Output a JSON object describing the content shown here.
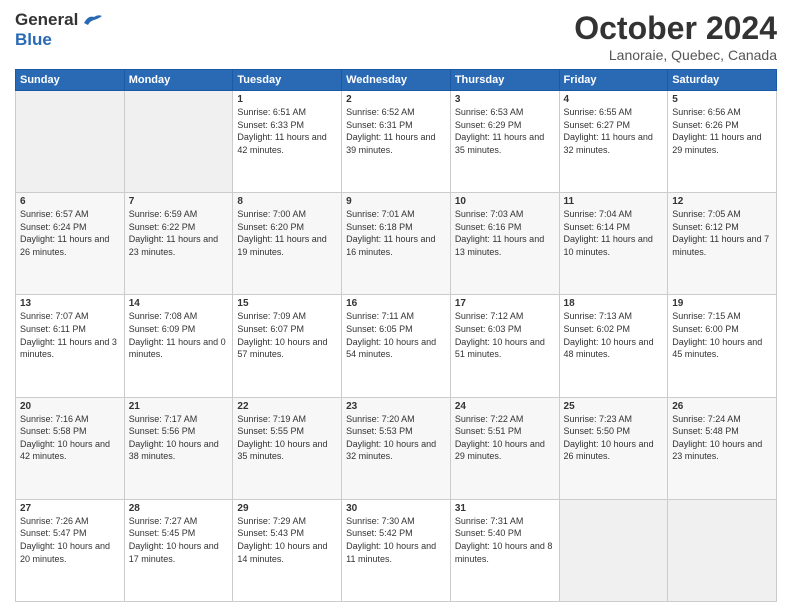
{
  "logo": {
    "line1": "General",
    "line2": "Blue"
  },
  "header": {
    "month_title": "October 2024",
    "location": "Lanoraie, Quebec, Canada"
  },
  "weekdays": [
    "Sunday",
    "Monday",
    "Tuesday",
    "Wednesday",
    "Thursday",
    "Friday",
    "Saturday"
  ],
  "weeks": [
    [
      {
        "day": "",
        "info": ""
      },
      {
        "day": "",
        "info": ""
      },
      {
        "day": "1",
        "info": "Sunrise: 6:51 AM\nSunset: 6:33 PM\nDaylight: 11 hours and 42 minutes."
      },
      {
        "day": "2",
        "info": "Sunrise: 6:52 AM\nSunset: 6:31 PM\nDaylight: 11 hours and 39 minutes."
      },
      {
        "day": "3",
        "info": "Sunrise: 6:53 AM\nSunset: 6:29 PM\nDaylight: 11 hours and 35 minutes."
      },
      {
        "day": "4",
        "info": "Sunrise: 6:55 AM\nSunset: 6:27 PM\nDaylight: 11 hours and 32 minutes."
      },
      {
        "day": "5",
        "info": "Sunrise: 6:56 AM\nSunset: 6:26 PM\nDaylight: 11 hours and 29 minutes."
      }
    ],
    [
      {
        "day": "6",
        "info": "Sunrise: 6:57 AM\nSunset: 6:24 PM\nDaylight: 11 hours and 26 minutes."
      },
      {
        "day": "7",
        "info": "Sunrise: 6:59 AM\nSunset: 6:22 PM\nDaylight: 11 hours and 23 minutes."
      },
      {
        "day": "8",
        "info": "Sunrise: 7:00 AM\nSunset: 6:20 PM\nDaylight: 11 hours and 19 minutes."
      },
      {
        "day": "9",
        "info": "Sunrise: 7:01 AM\nSunset: 6:18 PM\nDaylight: 11 hours and 16 minutes."
      },
      {
        "day": "10",
        "info": "Sunrise: 7:03 AM\nSunset: 6:16 PM\nDaylight: 11 hours and 13 minutes."
      },
      {
        "day": "11",
        "info": "Sunrise: 7:04 AM\nSunset: 6:14 PM\nDaylight: 11 hours and 10 minutes."
      },
      {
        "day": "12",
        "info": "Sunrise: 7:05 AM\nSunset: 6:12 PM\nDaylight: 11 hours and 7 minutes."
      }
    ],
    [
      {
        "day": "13",
        "info": "Sunrise: 7:07 AM\nSunset: 6:11 PM\nDaylight: 11 hours and 3 minutes."
      },
      {
        "day": "14",
        "info": "Sunrise: 7:08 AM\nSunset: 6:09 PM\nDaylight: 11 hours and 0 minutes."
      },
      {
        "day": "15",
        "info": "Sunrise: 7:09 AM\nSunset: 6:07 PM\nDaylight: 10 hours and 57 minutes."
      },
      {
        "day": "16",
        "info": "Sunrise: 7:11 AM\nSunset: 6:05 PM\nDaylight: 10 hours and 54 minutes."
      },
      {
        "day": "17",
        "info": "Sunrise: 7:12 AM\nSunset: 6:03 PM\nDaylight: 10 hours and 51 minutes."
      },
      {
        "day": "18",
        "info": "Sunrise: 7:13 AM\nSunset: 6:02 PM\nDaylight: 10 hours and 48 minutes."
      },
      {
        "day": "19",
        "info": "Sunrise: 7:15 AM\nSunset: 6:00 PM\nDaylight: 10 hours and 45 minutes."
      }
    ],
    [
      {
        "day": "20",
        "info": "Sunrise: 7:16 AM\nSunset: 5:58 PM\nDaylight: 10 hours and 42 minutes."
      },
      {
        "day": "21",
        "info": "Sunrise: 7:17 AM\nSunset: 5:56 PM\nDaylight: 10 hours and 38 minutes."
      },
      {
        "day": "22",
        "info": "Sunrise: 7:19 AM\nSunset: 5:55 PM\nDaylight: 10 hours and 35 minutes."
      },
      {
        "day": "23",
        "info": "Sunrise: 7:20 AM\nSunset: 5:53 PM\nDaylight: 10 hours and 32 minutes."
      },
      {
        "day": "24",
        "info": "Sunrise: 7:22 AM\nSunset: 5:51 PM\nDaylight: 10 hours and 29 minutes."
      },
      {
        "day": "25",
        "info": "Sunrise: 7:23 AM\nSunset: 5:50 PM\nDaylight: 10 hours and 26 minutes."
      },
      {
        "day": "26",
        "info": "Sunrise: 7:24 AM\nSunset: 5:48 PM\nDaylight: 10 hours and 23 minutes."
      }
    ],
    [
      {
        "day": "27",
        "info": "Sunrise: 7:26 AM\nSunset: 5:47 PM\nDaylight: 10 hours and 20 minutes."
      },
      {
        "day": "28",
        "info": "Sunrise: 7:27 AM\nSunset: 5:45 PM\nDaylight: 10 hours and 17 minutes."
      },
      {
        "day": "29",
        "info": "Sunrise: 7:29 AM\nSunset: 5:43 PM\nDaylight: 10 hours and 14 minutes."
      },
      {
        "day": "30",
        "info": "Sunrise: 7:30 AM\nSunset: 5:42 PM\nDaylight: 10 hours and 11 minutes."
      },
      {
        "day": "31",
        "info": "Sunrise: 7:31 AM\nSunset: 5:40 PM\nDaylight: 10 hours and 8 minutes."
      },
      {
        "day": "",
        "info": ""
      },
      {
        "day": "",
        "info": ""
      }
    ]
  ]
}
